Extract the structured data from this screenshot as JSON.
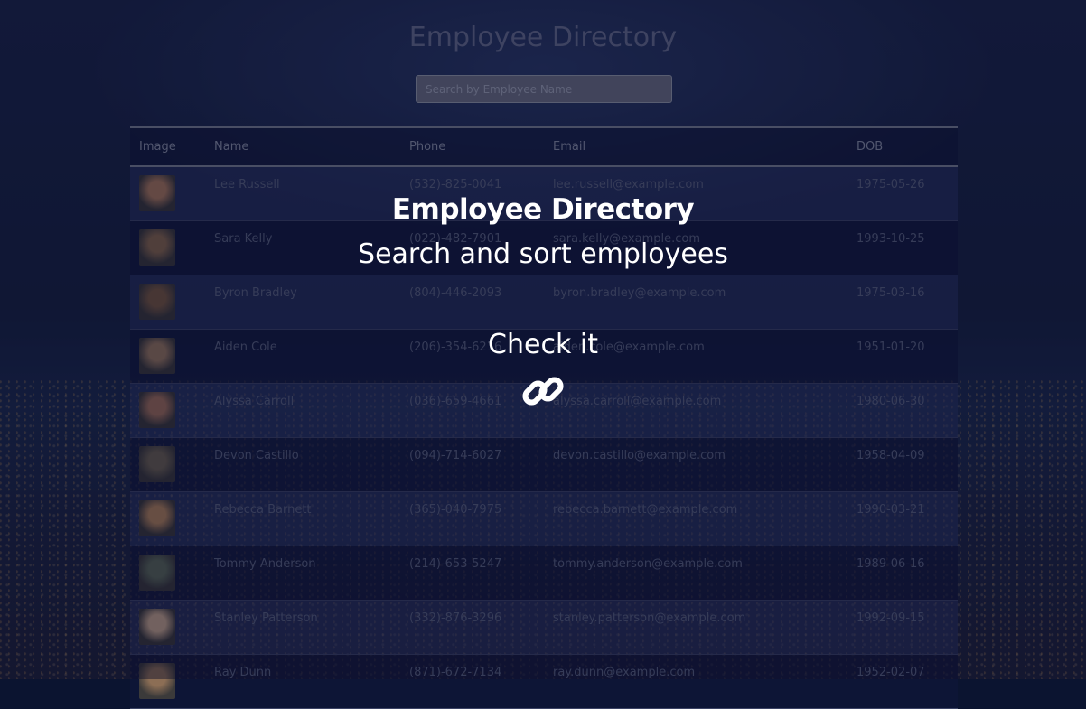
{
  "page": {
    "title": "Employee Directory"
  },
  "search": {
    "placeholder": "Search by Employee Name"
  },
  "table": {
    "headers": [
      "Image",
      "Name",
      "Phone",
      "Email",
      "DOB"
    ],
    "rows": [
      {
        "name": "Lee Russell",
        "phone": "(532)-825-0041",
        "email": "lee.russell@example.com",
        "dob": "1975-05-26",
        "avatar": "#b07d5c"
      },
      {
        "name": "Sara Kelly",
        "phone": "(022)-482-7901",
        "email": "sara.kelly@example.com",
        "dob": "1993-10-25",
        "avatar": "#8a6a4c"
      },
      {
        "name": "Byron Bradley",
        "phone": "(804)-446-2093",
        "email": "byron.bradley@example.com",
        "dob": "1975-03-16",
        "avatar": "#7a5a3f"
      },
      {
        "name": "Aiden Cole",
        "phone": "(206)-354-6216",
        "email": "aiden.cole@example.com",
        "dob": "1951-01-20",
        "avatar": "#9b7a5e"
      },
      {
        "name": "Alyssa Carroll",
        "phone": "(036)-659-4661",
        "email": "alyssa.carroll@example.com",
        "dob": "1980-06-30",
        "avatar": "#a4725a"
      },
      {
        "name": "Devon Castillo",
        "phone": "(094)-714-6027",
        "email": "devon.castillo@example.com",
        "dob": "1958-04-09",
        "avatar": "#6e6350"
      },
      {
        "name": "Rebecca Barnett",
        "phone": "(365)-040-7975",
        "email": "rebecca.barnett@example.com",
        "dob": "1990-03-21",
        "avatar": "#b4855a"
      },
      {
        "name": "Tommy Anderson",
        "phone": "(214)-653-5247",
        "email": "tommy.anderson@example.com",
        "dob": "1989-06-16",
        "avatar": "#5d6b58"
      },
      {
        "name": "Stanley Patterson",
        "phone": "(332)-876-3296",
        "email": "stanley.patterson@example.com",
        "dob": "1992-09-15",
        "avatar": "#c8a88c"
      },
      {
        "name": "Ray Dunn",
        "phone": "(871)-672-7134",
        "email": "ray.dunn@example.com",
        "dob": "1952-02-07",
        "avatar": "#8c6e55"
      }
    ]
  },
  "overlay": {
    "title": "Employee Directory",
    "subtitle": "Search and sort employees",
    "cta": "Check it"
  },
  "icons": {
    "link": "link-icon"
  }
}
